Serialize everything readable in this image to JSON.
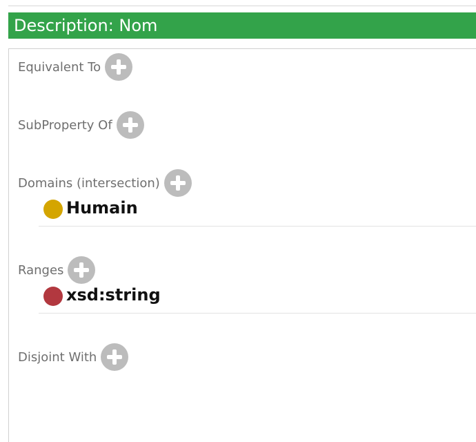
{
  "header": {
    "title": "Description: Nom",
    "color": "#33a34a"
  },
  "sections": [
    {
      "label": "Equivalent To",
      "add_icon": "plus-circle-icon",
      "items": []
    },
    {
      "label": "SubProperty Of",
      "add_icon": "plus-circle-icon",
      "items": []
    },
    {
      "label": "Domains (intersection)",
      "add_icon": "plus-circle-icon",
      "items": [
        {
          "name": "Humain",
          "icon": "class-icon",
          "color": "#d4a500"
        }
      ]
    },
    {
      "label": "Ranges",
      "add_icon": "plus-circle-icon",
      "items": [
        {
          "name": "xsd:string",
          "icon": "datatype-icon",
          "color": "#b2383f"
        }
      ]
    },
    {
      "label": "Disjoint With",
      "add_icon": "plus-circle-icon",
      "items": []
    }
  ]
}
